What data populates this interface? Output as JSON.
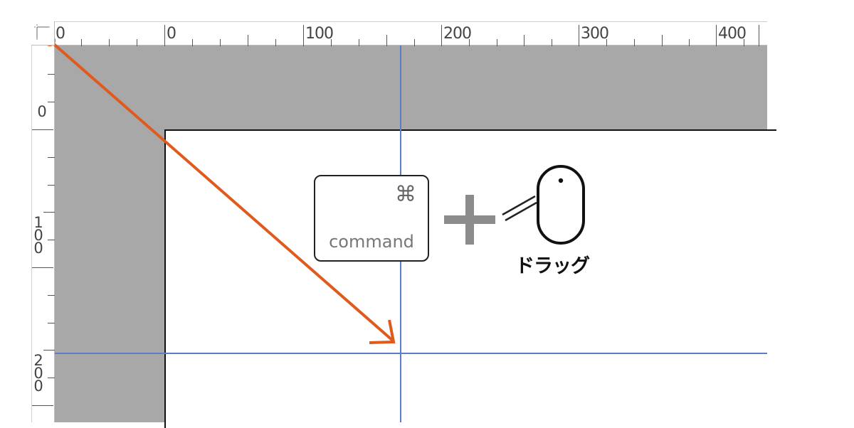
{
  "rulers": {
    "top_labels": [
      "0",
      "0",
      "100",
      "200",
      "300",
      "400"
    ],
    "left_labels": [
      "0",
      "100",
      "200"
    ]
  },
  "shortcut": {
    "key_symbol": "⌘",
    "key_label": "command",
    "action_label": "ドラッグ"
  },
  "colors": {
    "arrow": "#e05a1e",
    "guide": "#5b7fc7",
    "pasteboard": "#a8a8a8"
  },
  "icons": {
    "ruler_origin": "ruler-origin-icon",
    "plus": "plus-icon",
    "mouse": "mouse-icon",
    "arrow": "drag-arrow-icon"
  }
}
